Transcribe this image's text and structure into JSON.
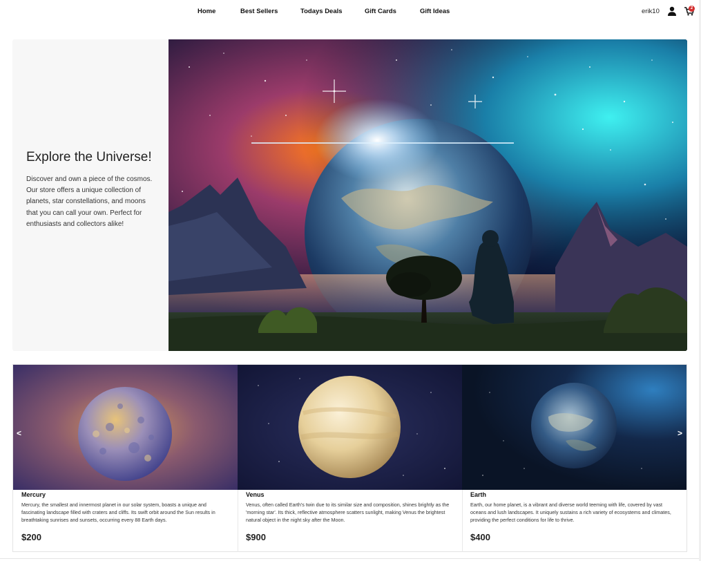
{
  "nav": {
    "links": [
      "Home",
      "Best Sellers",
      "Todays Deals",
      "Gift Cards",
      "Gift Ideas"
    ],
    "username": "erik10",
    "cart_count": "2",
    "user_icon": "user-icon",
    "cart_icon": "cart-icon"
  },
  "hero": {
    "title": "Explore the Universe!",
    "description": "Discover and own a piece of the cosmos. Our store offers a unique collection of planets, star constellations, and moons that you can call your own. Perfect for enthusiasts and collectors alike!"
  },
  "products": [
    {
      "name": "Mercury",
      "description": "Mercury, the smallest and innermost planet in our solar system, boasts a unique and fascinating landscape filled with craters and cliffs. Its swift orbit around the Sun results in breathtaking sunrises and sunsets, occurring every 88 Earth days.",
      "price": "$200"
    },
    {
      "name": "Venus",
      "description": "Venus, often called Earth's twin due to its similar size and composition, shines brightly as the 'morning star'. Its thick, reflective atmosphere scatters sunlight, making Venus the brightest natural object in the night sky after the Moon.",
      "price": "$900"
    },
    {
      "name": "Earth",
      "description": "Earth, our home planet, is a vibrant and diverse world teeming with life, covered by vast oceans and lush landscapes. It uniquely sustains a rich variety of ecosystems and climates, providing the perfect conditions for life to thrive.",
      "price": "$400"
    }
  ],
  "carousel": {
    "prev": "<",
    "next": ">"
  },
  "colors": {
    "badge": "#d32f2f",
    "hero_panel": "#f7f7f7"
  }
}
